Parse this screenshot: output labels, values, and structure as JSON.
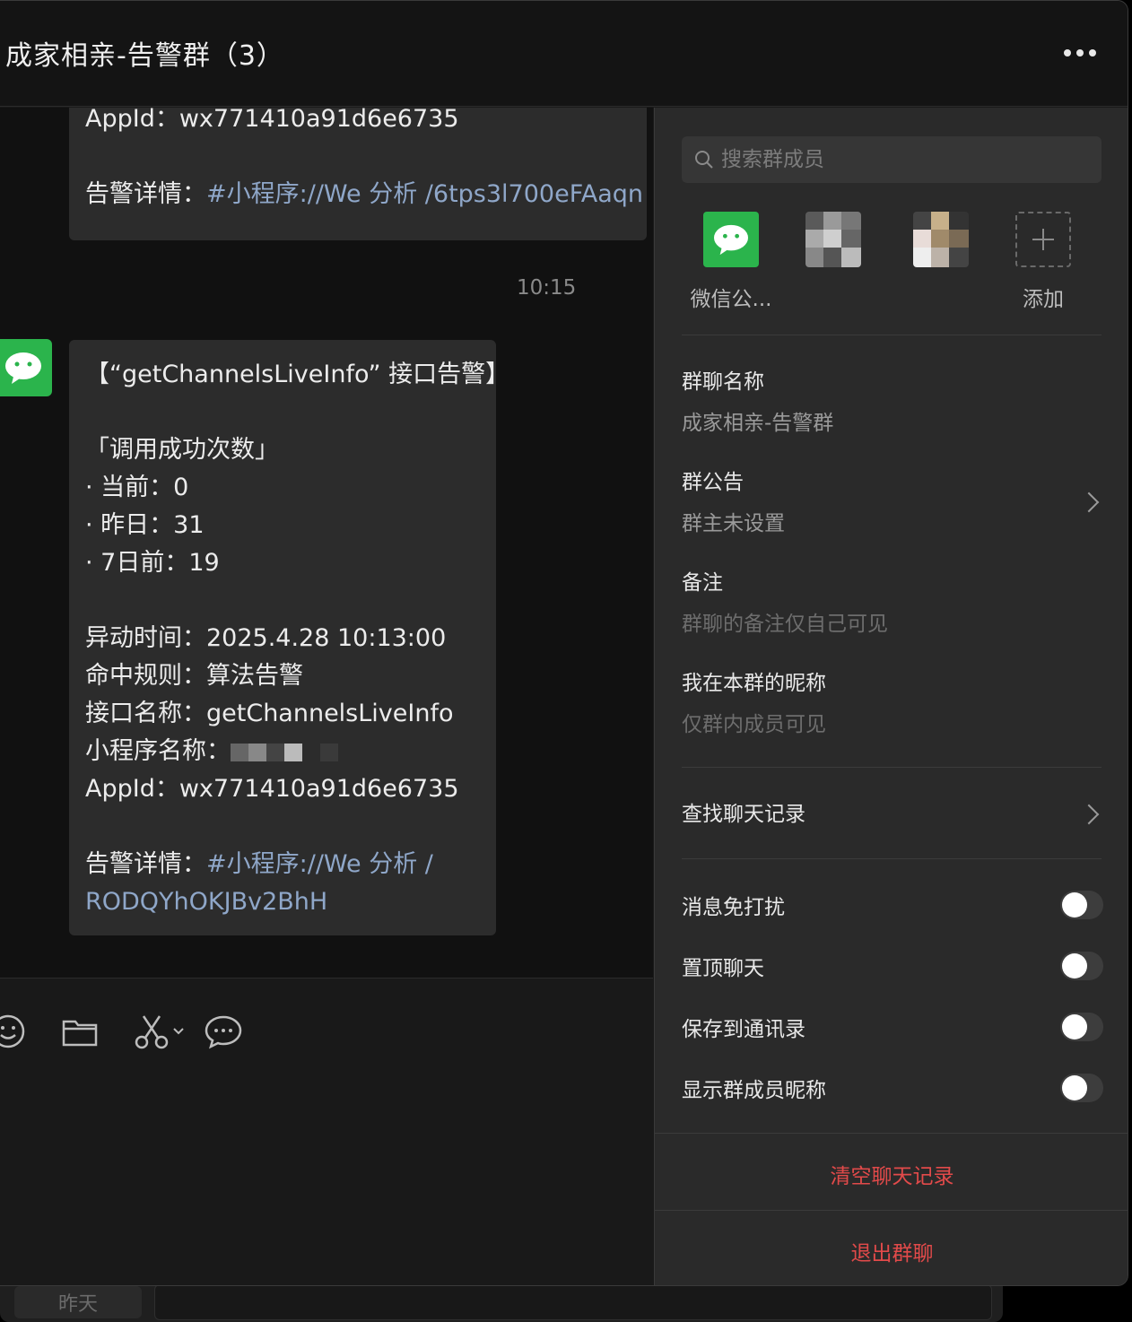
{
  "header": {
    "title": "成家相亲-告警群（3）"
  },
  "chat": {
    "prev_message": {
      "appid": "AppId：wx771410a91d6e6735",
      "detail_label": "告警详情：",
      "detail_link": "#小程序://We 分析 /6tps3l700eFAaqn"
    },
    "timestamp": "10:15",
    "message": {
      "title": "【“getChannelsLiveInfo” 接口告警】",
      "section": "「调用成功次数」",
      "current": "· 当前：0",
      "yesterday": "· 昨日：31",
      "week_ago": "· 7日前：19",
      "time": "异动时间：2025.4.28  10:13:00",
      "rule": "命中规则：算法告警",
      "api_name": "接口名称：getChannelsLiveInfo",
      "mp_name_label": "小程序名称：",
      "appid": "AppId：wx771410a91d6e6735",
      "detail_label": "告警详情：",
      "detail_link_1": "#小程序://We 分析 /",
      "detail_link_2": "RODQYhOKJBv2BhH"
    }
  },
  "panel": {
    "search_placeholder": "搜索群成员",
    "members": [
      {
        "name": "微信公..."
      },
      {
        "name": ""
      },
      {
        "name": ""
      },
      {
        "name": "添加"
      }
    ],
    "group_name_label": "群聊名称",
    "group_name_value": "成家相亲-告警群",
    "notice_label": "群公告",
    "notice_value": "群主未设置",
    "remark_label": "备注",
    "remark_value": "群聊的备注仅自己可见",
    "nickname_label": "我在本群的昵称",
    "nickname_value": "仅群内成员可见",
    "search_history": "查找聊天记录",
    "toggles": [
      {
        "label": "消息免打扰",
        "on": false
      },
      {
        "label": "置顶聊天",
        "on": false
      },
      {
        "label": "保存到通讯录",
        "on": false
      },
      {
        "label": "显示群成员昵称",
        "on": false
      }
    ],
    "clear_history": "清空聊天记录",
    "leave_group": "退出群聊"
  },
  "background": {
    "tab_label": "昨天"
  }
}
